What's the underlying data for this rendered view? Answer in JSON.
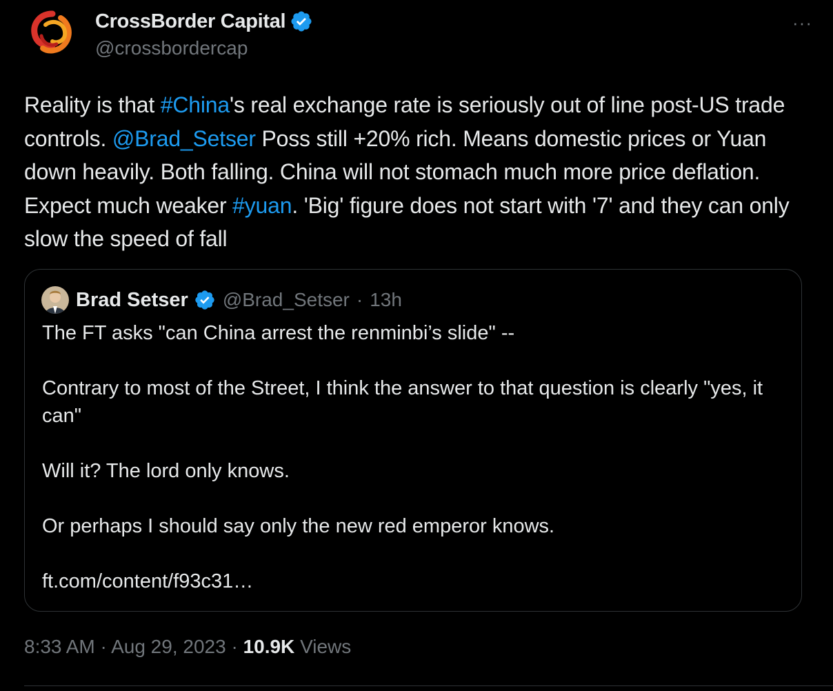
{
  "author": {
    "display_name": "CrossBorder Capital",
    "handle": "@crossbordercap",
    "verified_icon": "verified-badge-icon"
  },
  "more_label": "···",
  "tweet": {
    "segments": [
      {
        "text": "Reality is that ",
        "link": false
      },
      {
        "text": "#China",
        "link": true
      },
      {
        "text": "'s real exchange rate is seriously out of line post-US trade controls. ",
        "link": false
      },
      {
        "text": "@Brad_Setser",
        "link": true
      },
      {
        "text": " Poss still +20% rich. Means domestic prices or Yuan down heavily. Both falling. China will not stomach much more price deflation. Expect much weaker ",
        "link": false
      },
      {
        "text": "#yuan",
        "link": true
      },
      {
        "text": ". 'Big' figure does not start with '7' and they can only slow the speed of fall",
        "link": false
      }
    ]
  },
  "quoted": {
    "display_name": "Brad Setser",
    "handle": "@Brad_Setser",
    "separator": "·",
    "time": "13h",
    "paragraphs": [
      "The FT asks \"can China arrest the renminbi’s slide\" --",
      "Contrary to most of the Street, I think the answer to that question is clearly \"yes, it can\"",
      "Will it?  The lord only knows.",
      "Or perhaps I should say only the new red emperor knows.",
      "ft.com/content/f93c31…"
    ]
  },
  "meta": {
    "time": "8:33 AM",
    "sep1": "·",
    "date": "Aug 29, 2023",
    "sep2": "·",
    "views_count": "10.9K",
    "views_label": "Views"
  },
  "colors": {
    "background": "#000000",
    "text": "#e7e9ea",
    "secondary": "#71767b",
    "link": "#1d9bf0",
    "border": "#2f3336"
  }
}
